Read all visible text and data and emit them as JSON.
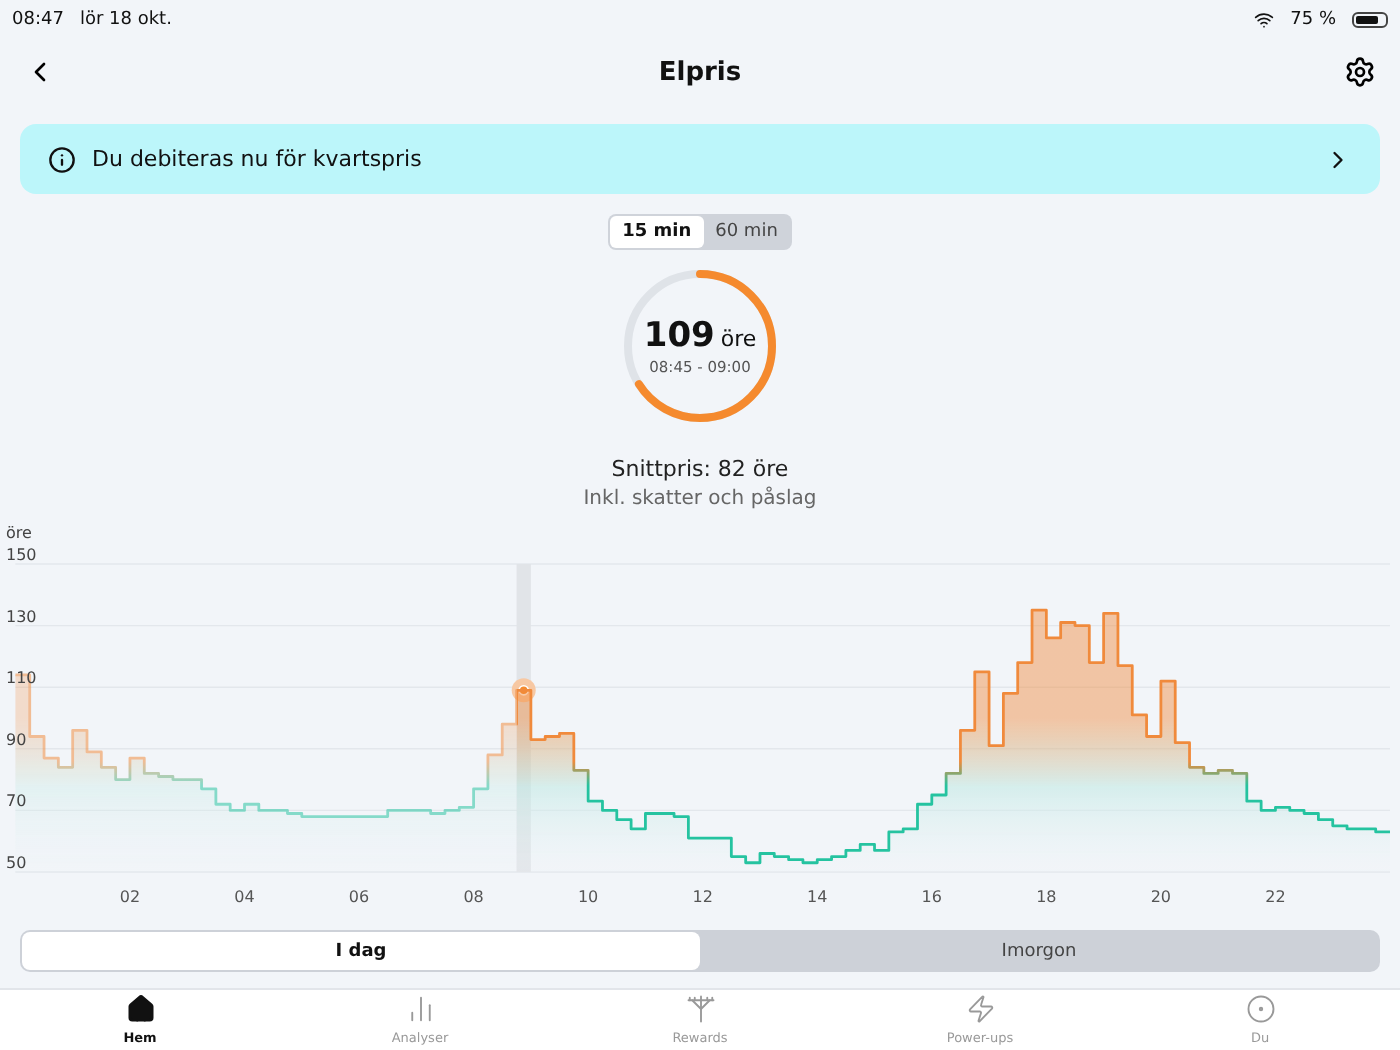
{
  "status_bar": {
    "time": "08:47",
    "date": "lör 18 okt.",
    "battery": "75 %"
  },
  "header": {
    "title": "Elpris"
  },
  "notice": {
    "text": "Du debiteras nu för kvartspris"
  },
  "interval_toggle": [
    {
      "label": "15 min",
      "selected": true
    },
    {
      "label": "60 min",
      "selected": false
    }
  ],
  "current_price": {
    "value": "109",
    "unit": "öre",
    "time_range": "08:45 - 09:00",
    "level": 0.66
  },
  "average": {
    "text": "Snittpris: 82 öre",
    "note": "Inkl. skatter och påslag"
  },
  "chart": {
    "chart_data": {
      "type": "area",
      "ylabel": "öre",
      "xlim": [
        0,
        24
      ],
      "ylim": [
        50,
        150
      ],
      "grid": true,
      "yticks": [
        50,
        70,
        90,
        110,
        130,
        150
      ],
      "xticks": [
        {
          "value": 2,
          "label": "02"
        },
        {
          "value": 4,
          "label": "04"
        },
        {
          "value": 6,
          "label": "06"
        },
        {
          "value": 8,
          "label": "08"
        },
        {
          "value": 10,
          "label": "10"
        },
        {
          "value": 12,
          "label": "12"
        },
        {
          "value": 14,
          "label": "14"
        },
        {
          "value": 16,
          "label": "16"
        },
        {
          "value": 18,
          "label": "18"
        },
        {
          "value": 20,
          "label": "20"
        },
        {
          "value": 22,
          "label": "22"
        }
      ],
      "x": [
        0,
        0.25,
        0.25,
        0.5,
        0.5,
        0.75,
        0.75,
        1,
        1,
        1.25,
        1.25,
        1.5,
        1.5,
        1.75,
        1.75,
        2,
        2,
        2.25,
        2.25,
        2.5,
        2.5,
        2.75,
        2.75,
        3,
        3,
        3.25,
        3.25,
        3.5,
        3.5,
        3.75,
        3.75,
        4,
        4,
        4.25,
        4.25,
        4.5,
        4.5,
        4.75,
        4.75,
        5,
        5,
        5.25,
        5.25,
        5.5,
        5.5,
        5.75,
        5.75,
        6,
        6,
        6.25,
        6.25,
        6.5,
        6.5,
        6.75,
        6.75,
        7,
        7,
        7.25,
        7.25,
        7.5,
        7.5,
        7.75,
        7.75,
        8,
        8,
        8.25,
        8.25,
        8.5,
        8.5,
        8.75,
        8.75,
        9,
        9,
        9.25,
        9.25,
        9.5,
        9.5,
        9.75,
        9.75,
        10,
        10,
        10.25,
        10.25,
        10.5,
        10.5,
        10.75,
        10.75,
        11,
        11,
        11.25,
        11.25,
        11.5,
        11.5,
        11.75,
        11.75,
        12,
        12,
        12.25,
        12.25,
        12.5,
        12.5,
        12.75,
        12.75,
        13,
        13,
        13.25,
        13.25,
        13.5,
        13.5,
        13.75,
        13.75,
        14,
        14,
        14.25,
        14.25,
        14.5,
        14.5,
        14.75,
        14.75,
        15,
        15,
        15.25,
        15.25,
        15.5,
        15.5,
        15.75,
        15.75,
        16,
        16,
        16.25,
        16.25,
        16.5,
        16.5,
        16.75,
        16.75,
        17,
        17,
        17.25,
        17.25,
        17.5,
        17.5,
        17.75,
        17.75,
        18,
        18,
        18.25,
        18.25,
        18.5,
        18.5,
        18.75,
        18.75,
        19,
        19,
        19.25,
        19.25,
        19.5,
        19.5,
        19.75,
        19.75,
        20,
        20,
        20.25,
        20.25,
        20.5,
        20.5,
        20.75,
        20.75,
        21,
        21,
        21.25,
        21.25,
        21.5,
        21.5,
        21.75,
        21.75,
        22,
        22,
        22.25,
        22.25,
        22.5,
        22.5,
        22.75,
        22.75,
        23,
        23,
        23.25,
        23.25,
        23.5,
        23.5,
        23.75,
        23.75,
        24
      ],
      "series": [
        {
          "color": "#f08a3c",
          "values": [
            114,
            114,
            94,
            94,
            87,
            87,
            84,
            84,
            96,
            96,
            89,
            89,
            84,
            84,
            80,
            80,
            87,
            87,
            82,
            82,
            81,
            81,
            80,
            80,
            80,
            80,
            77,
            77,
            72,
            72,
            70,
            70,
            72,
            72,
            70,
            70,
            70,
            70,
            69,
            69,
            68,
            68,
            68,
            68,
            68,
            68,
            68,
            68,
            68,
            68,
            68,
            68,
            70,
            70,
            70,
            70,
            70,
            70,
            69,
            69,
            70,
            70,
            71,
            71,
            77,
            77,
            88,
            88,
            98,
            98,
            109,
            109,
            93,
            93,
            94,
            94,
            95,
            95,
            83,
            83,
            73,
            73,
            70,
            70,
            67,
            67,
            64,
            64,
            69,
            69,
            69,
            69,
            68,
            68,
            61,
            61,
            61,
            61,
            61,
            61,
            55,
            55,
            53,
            53,
            56,
            56,
            55,
            55,
            54,
            54,
            53,
            53,
            54,
            54,
            55,
            55,
            57,
            57,
            59,
            59,
            57,
            57,
            63,
            63,
            64,
            64,
            72,
            72,
            75,
            75,
            82,
            82,
            96,
            96,
            115,
            115,
            91,
            91,
            108,
            108,
            118,
            118,
            135,
            135,
            126,
            126,
            131,
            131,
            130,
            130,
            118,
            118,
            134,
            134,
            117,
            117,
            101,
            101,
            94,
            94,
            112,
            112,
            92,
            92,
            84,
            84,
            82,
            82,
            83,
            83,
            82,
            82,
            73,
            73,
            70,
            70,
            71,
            71,
            70,
            70,
            69,
            69,
            67,
            67,
            65,
            65,
            64,
            64,
            64,
            64,
            63,
            63
          ]
        }
      ],
      "bands": [
        {
          "axis": "x",
          "from": 8.75,
          "to": 9
        }
      ]
    }
  },
  "day_tabs": [
    {
      "label": "I dag",
      "selected": true
    },
    {
      "label": "Imorgon",
      "selected": false
    }
  ],
  "nav": [
    {
      "label": "Hem",
      "kind": "home",
      "selected": true
    },
    {
      "label": "Analyser",
      "kind": "chart",
      "selected": false
    },
    {
      "label": "Rewards",
      "kind": "tower",
      "selected": false
    },
    {
      "label": "Power-ups",
      "kind": "bolt",
      "selected": false
    },
    {
      "label": "Du",
      "kind": "profile",
      "selected": false
    }
  ]
}
